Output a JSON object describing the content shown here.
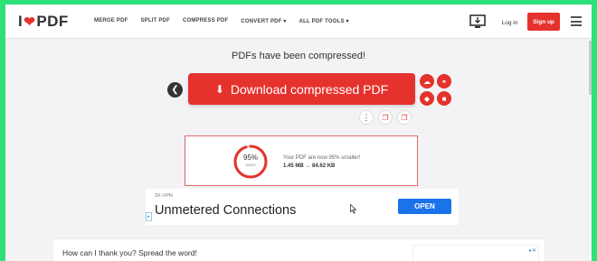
{
  "header": {
    "logo_left": "I",
    "logo_right": "PDF",
    "nav": [
      "MERGE PDF",
      "SPLIT PDF",
      "COMPRESS PDF",
      "CONVERT PDF ▾",
      "ALL PDF TOOLS ▾"
    ],
    "login": "Log in",
    "signup": "Sign up"
  },
  "main": {
    "headline": "PDFs have been compressed!",
    "download_label": "Download compressed PDF",
    "result": {
      "percent_label": "95%",
      "percent_value": 95,
      "saved_label": "SAVED",
      "line1": "Your PDF are now 95% smaller!",
      "line2": "1.45 MB → 84.62 KB"
    }
  },
  "ad": {
    "brand": "3X-VPN",
    "title": "Unmetered Connections",
    "cta": "OPEN"
  },
  "share": {
    "text": "How can I thank you? Spread the word!"
  },
  "colors": {
    "brand_red": "#e5322d",
    "frame_green": "#2ee07a",
    "cta_blue": "#1a73e8"
  }
}
